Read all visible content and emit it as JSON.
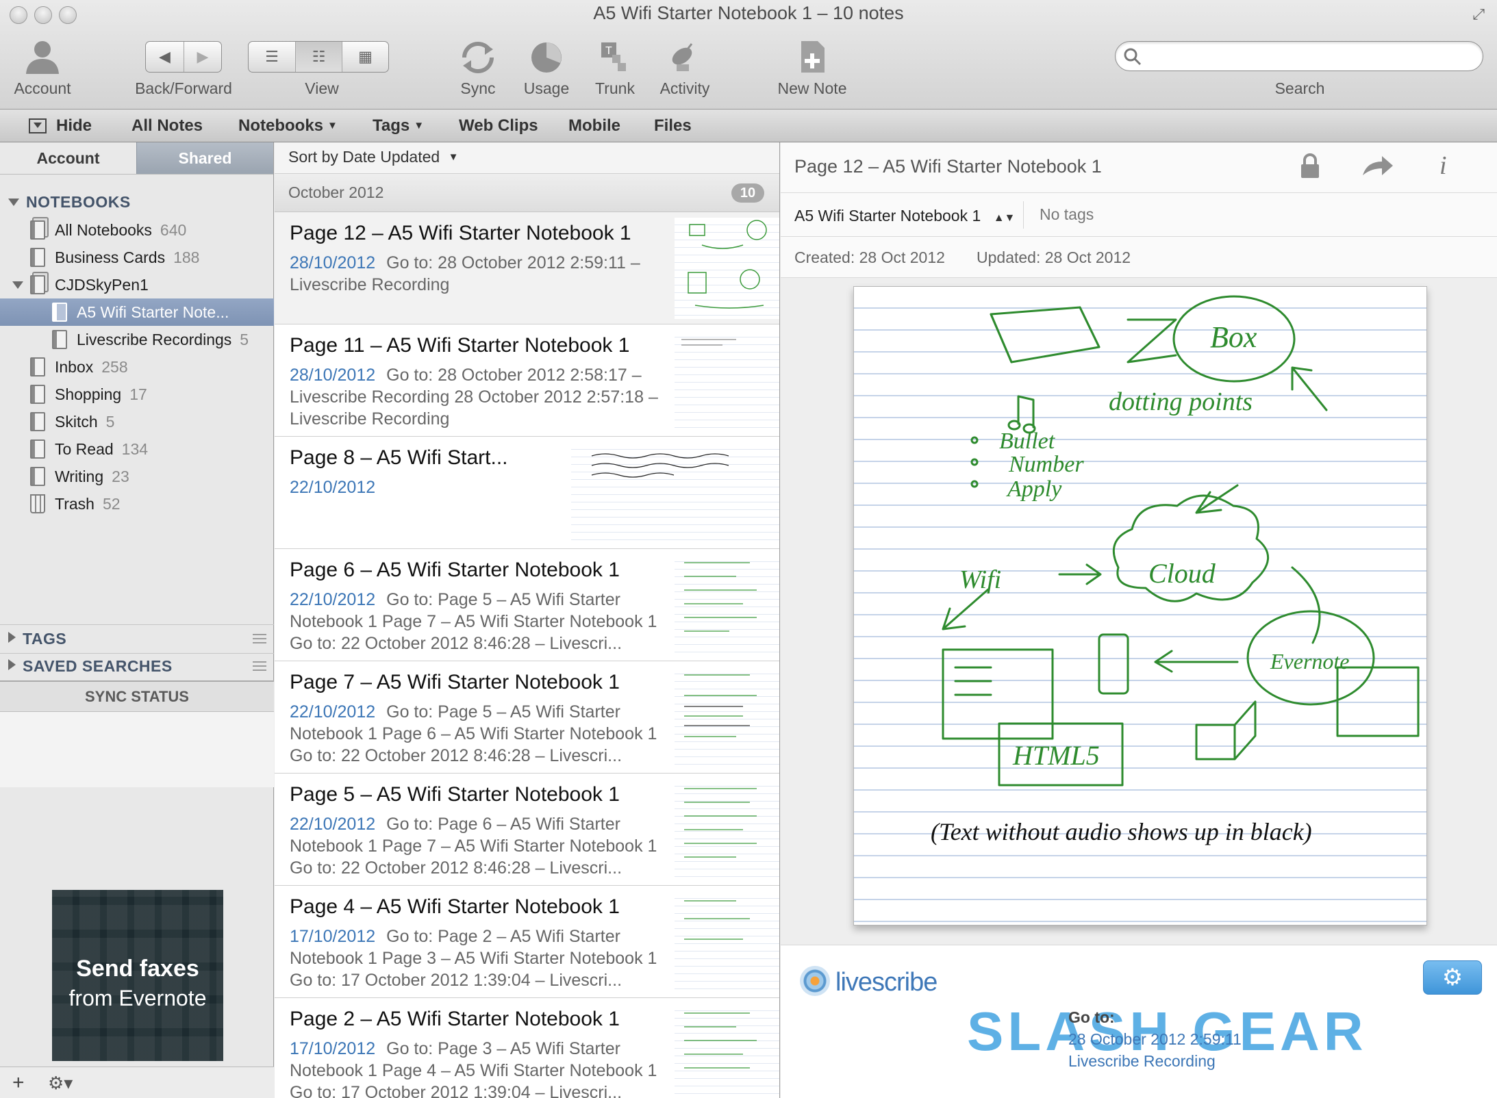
{
  "window": {
    "title": "A5 Wifi Starter Notebook 1 – 10 notes"
  },
  "toolbar": {
    "account": "Account",
    "back_forward": "Back/Forward",
    "view": "View",
    "sync": "Sync",
    "usage": "Usage",
    "trunk": "Trunk",
    "activity": "Activity",
    "new_note": "New Note",
    "search_label": "Search",
    "search_value": ""
  },
  "nav": {
    "hide": "Hide",
    "all_notes": "All Notes",
    "notebooks": "Notebooks",
    "tags": "Tags",
    "web_clips": "Web Clips",
    "mobile": "Mobile",
    "files": "Files"
  },
  "sidebar": {
    "tab_account": "Account",
    "tab_shared": "Shared",
    "notebooks_header": "NOTEBOOKS",
    "notebooks": [
      {
        "name": "All Notebooks",
        "count": "640"
      },
      {
        "name": "Business Cards",
        "count": "188"
      },
      {
        "name": "CJDSkyPen1",
        "count": ""
      },
      {
        "name": "A5 Wifi Starter Note...",
        "count": ""
      },
      {
        "name": "Livescribe Recordings",
        "count": "5"
      },
      {
        "name": "Inbox",
        "count": "258"
      },
      {
        "name": "Shopping",
        "count": "17"
      },
      {
        "name": "Skitch",
        "count": "5"
      },
      {
        "name": "To Read",
        "count": "134"
      },
      {
        "name": "Writing",
        "count": "23"
      },
      {
        "name": "Trash",
        "count": "52"
      }
    ],
    "tags_header": "TAGS",
    "saved_searches_header": "SAVED SEARCHES",
    "sync_status": "SYNC STATUS",
    "ad_line1": "Send faxes",
    "ad_line2": "from Evernote"
  },
  "note_list": {
    "sort_label": "Sort by Date Updated",
    "month": "October 2012",
    "month_count": "10",
    "notes": [
      {
        "title": "Page 12 – A5 Wifi Starter Notebook 1",
        "date": "28/10/2012",
        "snippet": "Go to: 28 October 2012 2:59:11 – Livescribe Recording"
      },
      {
        "title": "Page 11 – A5 Wifi Starter Notebook 1",
        "date": "28/10/2012",
        "snippet": "Go to: 28 October 2012 2:58:17 – Livescribe Recording 28 October 2012 2:57:18 – Livescribe Recording"
      },
      {
        "title": "Page 8 – A5 Wifi Start...",
        "date": "22/10/2012",
        "snippet": ""
      },
      {
        "title": "Page 6 – A5 Wifi Starter Notebook 1",
        "date": "22/10/2012",
        "snippet": "Go to: Page 5 – A5 Wifi Starter Notebook 1 Page 7 – A5 Wifi Starter Notebook 1 Go to: 22 October 2012 8:46:28 – Livescri..."
      },
      {
        "title": "Page 7 – A5 Wifi Starter Notebook 1",
        "date": "22/10/2012",
        "snippet": "Go to: Page 5 – A5 Wifi Starter Notebook 1 Page 6 – A5 Wifi Starter Notebook 1 Go to: 22 October 2012 8:46:28 – Livescri..."
      },
      {
        "title": "Page 5 – A5 Wifi Starter Notebook 1",
        "date": "22/10/2012",
        "snippet": "Go to: Page 6 – A5 Wifi Starter Notebook 1 Page 7 – A5 Wifi Starter Notebook 1 Go to: 22 October 2012 8:46:28 – Livescri..."
      },
      {
        "title": "Page 4 – A5 Wifi Starter Notebook 1",
        "date": "17/10/2012",
        "snippet": "Go to: Page 2 – A5 Wifi Starter Notebook 1 Page 3 – A5 Wifi Starter Notebook 1 Go to: 17 October 2012 1:39:04 – Livescri..."
      },
      {
        "title": "Page 2 – A5 Wifi Starter Notebook 1",
        "date": "17/10/2012",
        "snippet": "Go to: Page 3 – A5 Wifi Starter Notebook 1 Page 4 – A5 Wifi Starter Notebook 1 Go to: 17 October 2012 1:39:04 – Livescri..."
      }
    ]
  },
  "detail": {
    "title": "Page 12 – A5 Wifi Starter Notebook 1",
    "notebook": "A5 Wifi Starter Notebook 1",
    "tags": "No tags",
    "created": "Created: 28 Oct 2012",
    "updated": "Updated: 28 Oct 2012",
    "handwriting": {
      "words": [
        "Box",
        "dotting points",
        "Bullet",
        "Number",
        "Apply",
        "Wifi",
        "Cloud",
        "Evernote",
        "HTML5",
        "(Text without audio shows up in black)"
      ],
      "ink_color": "#2e8b2e",
      "black_ink": "#111111"
    },
    "livescribe_logo": "livescribe",
    "goto_label": "Go to:",
    "goto_time": "28 October 2012 2:59:11",
    "goto_recording": "Livescribe Recording",
    "watermark": "SLASH GEAR"
  },
  "colors": {
    "link_blue": "#3c76b6",
    "selection": "#8a9dbd",
    "accent": "#4a9ad9"
  }
}
